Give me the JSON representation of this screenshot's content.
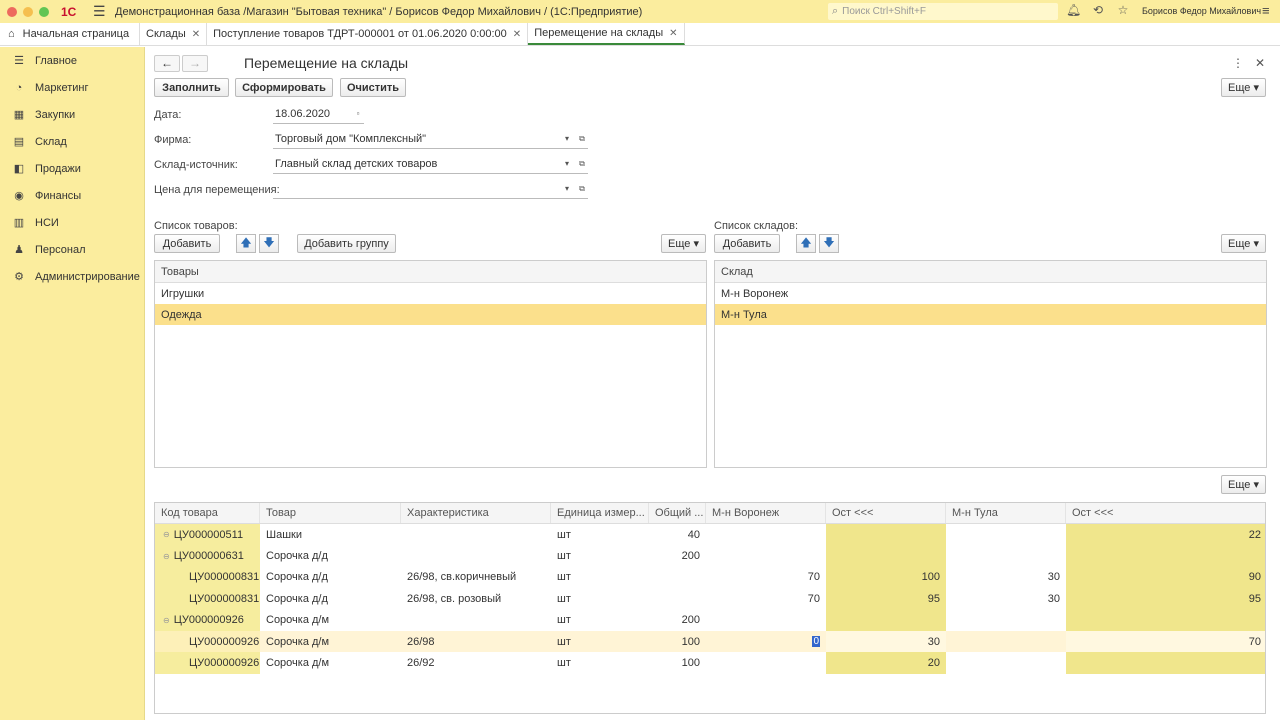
{
  "app": {
    "logo": "1С",
    "title": "Демонстрационная база /Магазин \"Бытовая техника\" / Борисов Федор Михайлович /  (1С:Предприятие)",
    "search_placeholder": "Поиск Ctrl+Shift+F",
    "user": "Борисов Федор Михайлович"
  },
  "tabs": [
    {
      "label": "Начальная страница"
    },
    {
      "label": "Склады"
    },
    {
      "label": "Поступление товаров ТДРТ-000001 от 01.06.2020 0:00:00"
    },
    {
      "label": "Перемещение на склады"
    }
  ],
  "sidebar": {
    "items": [
      {
        "label": "Главное",
        "icon": "menu-icon"
      },
      {
        "label": "Маркетинг",
        "icon": "pie-chart-icon"
      },
      {
        "label": "Закупки",
        "icon": "cart-icon"
      },
      {
        "label": "Склад",
        "icon": "warehouse-icon"
      },
      {
        "label": "Продажи",
        "icon": "sales-icon"
      },
      {
        "label": "Финансы",
        "icon": "finance-icon"
      },
      {
        "label": "НСИ",
        "icon": "reference-icon"
      },
      {
        "label": "Персонал",
        "icon": "person-icon"
      },
      {
        "label": "Администрирование",
        "icon": "gear-icon"
      }
    ]
  },
  "form": {
    "title": "Перемещение на склады",
    "toolbar": {
      "fill": "Заполнить",
      "generate": "Сформировать",
      "clear": "Очистить",
      "more": "Еще"
    },
    "date_label": "Дата:",
    "date_value": "18.06.2020",
    "firm_label": "Фирма:",
    "firm_value": "Торговый дом \"Комплексный\"",
    "source_label": "Склад-источник:",
    "source_value": "Главный склад детских товаров",
    "price_label": "Цена для перемещения:",
    "price_value": ""
  },
  "goods_list": {
    "label": "Список товаров:",
    "add": "Добавить",
    "add_group": "Добавить группу",
    "more": "Еще",
    "header": "Товары",
    "rows": [
      "Игрушки",
      "Одежда"
    ],
    "selected": 1
  },
  "stores_list": {
    "label": "Список складов:",
    "add": "Добавить",
    "more": "Еще",
    "header": "Склад",
    "rows": [
      "М-н Воронеж",
      "М-н Тула"
    ],
    "selected": 1
  },
  "table": {
    "more": "Еще",
    "columns": [
      "Код товара",
      "Товар",
      "Характеристика",
      "Единица измер...",
      "Общий ...",
      "М-н Воронеж",
      "Ост <<<",
      "М-н Тула",
      "Ост <<<"
    ],
    "rows": [
      {
        "code": "ЦУ000000511",
        "name": "Шашки",
        "char": "",
        "unit": "шт",
        "total": "40",
        "vor": "",
        "ost1": "",
        "tula": "",
        "ost2": "22",
        "level": 0
      },
      {
        "code": "ЦУ000000631",
        "name": "Сорочка д/д",
        "char": "",
        "unit": "шт",
        "total": "200",
        "vor": "",
        "ost1": "",
        "tula": "",
        "ost2": "",
        "level": 0
      },
      {
        "code": "ЦУ000000831",
        "name": "Сорочка д/д",
        "char": "26/98, св.коричневый",
        "unit": "шт",
        "total": "",
        "vor": "70",
        "ost1": "100",
        "tula": "30",
        "ost2": "90",
        "level": 1
      },
      {
        "code": "ЦУ000000831",
        "name": "Сорочка д/д",
        "char": "26/98, св. розовый",
        "unit": "шт",
        "total": "",
        "vor": "70",
        "ost1": "95",
        "tula": "30",
        "ost2": "95",
        "level": 1
      },
      {
        "code": "ЦУ000000926",
        "name": "Сорочка д/м",
        "char": "",
        "unit": "шт",
        "total": "200",
        "vor": "",
        "ost1": "",
        "tula": "",
        "ost2": "",
        "level": 0
      },
      {
        "code": "ЦУ000000926",
        "name": "Сорочка д/м",
        "char": "26/98",
        "unit": "шт",
        "total": "100",
        "vor": "0",
        "ost1": "30",
        "tula": "",
        "ost2": "70",
        "level": 1
      },
      {
        "code": "ЦУ000000926",
        "name": "Сорочка д/м",
        "char": "26/92",
        "unit": "шт",
        "total": "100",
        "vor": "",
        "ost1": "20",
        "tula": "",
        "ost2": "",
        "level": 1
      }
    ]
  },
  "colors": {
    "brand_yellow": "#fbed9e",
    "selected_row": "#fbe08c",
    "highlight_col": "#f0e68c"
  }
}
